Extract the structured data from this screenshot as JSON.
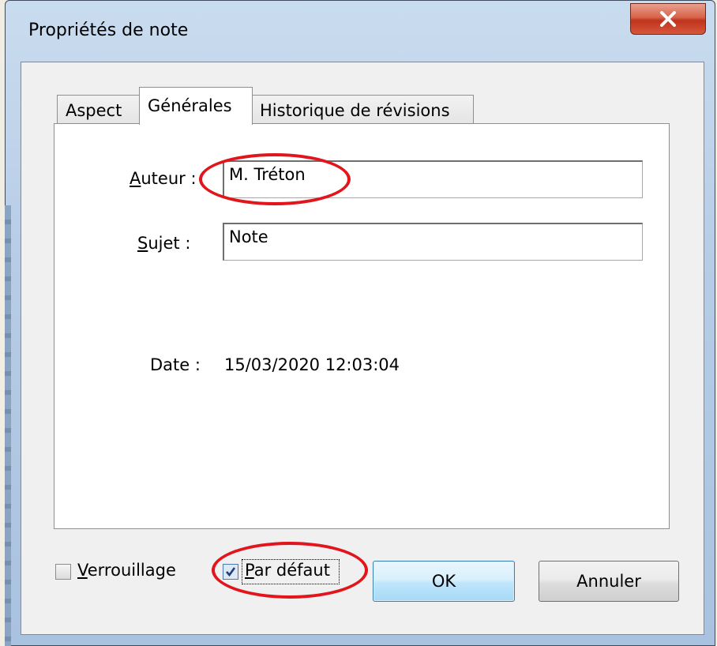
{
  "window": {
    "title": "Propriétés de note",
    "close_icon": "close-icon"
  },
  "tabs": [
    {
      "label": "Aspect",
      "active": false
    },
    {
      "label": "Générales",
      "active": true
    },
    {
      "label": "Historique de révisions",
      "active": false
    }
  ],
  "form": {
    "author_label_accel": "A",
    "author_label_rest": "uteur :",
    "author_value": "M. Tréton",
    "subject_label_accel": "S",
    "subject_label_rest": "ujet :",
    "subject_value": "Note",
    "date_label": "Date :",
    "date_value": "15/03/2020 12:03:04"
  },
  "footer": {
    "lock_label_accel": "V",
    "lock_label_rest": "errouillage",
    "lock_checked": false,
    "default_label_accel": "P",
    "default_label_rest": "ar défaut",
    "default_checked": true,
    "ok_label": "OK",
    "cancel_label": "Annuler"
  },
  "colors": {
    "highlight": "#e2141c",
    "ok_border": "#3c7fb1"
  }
}
